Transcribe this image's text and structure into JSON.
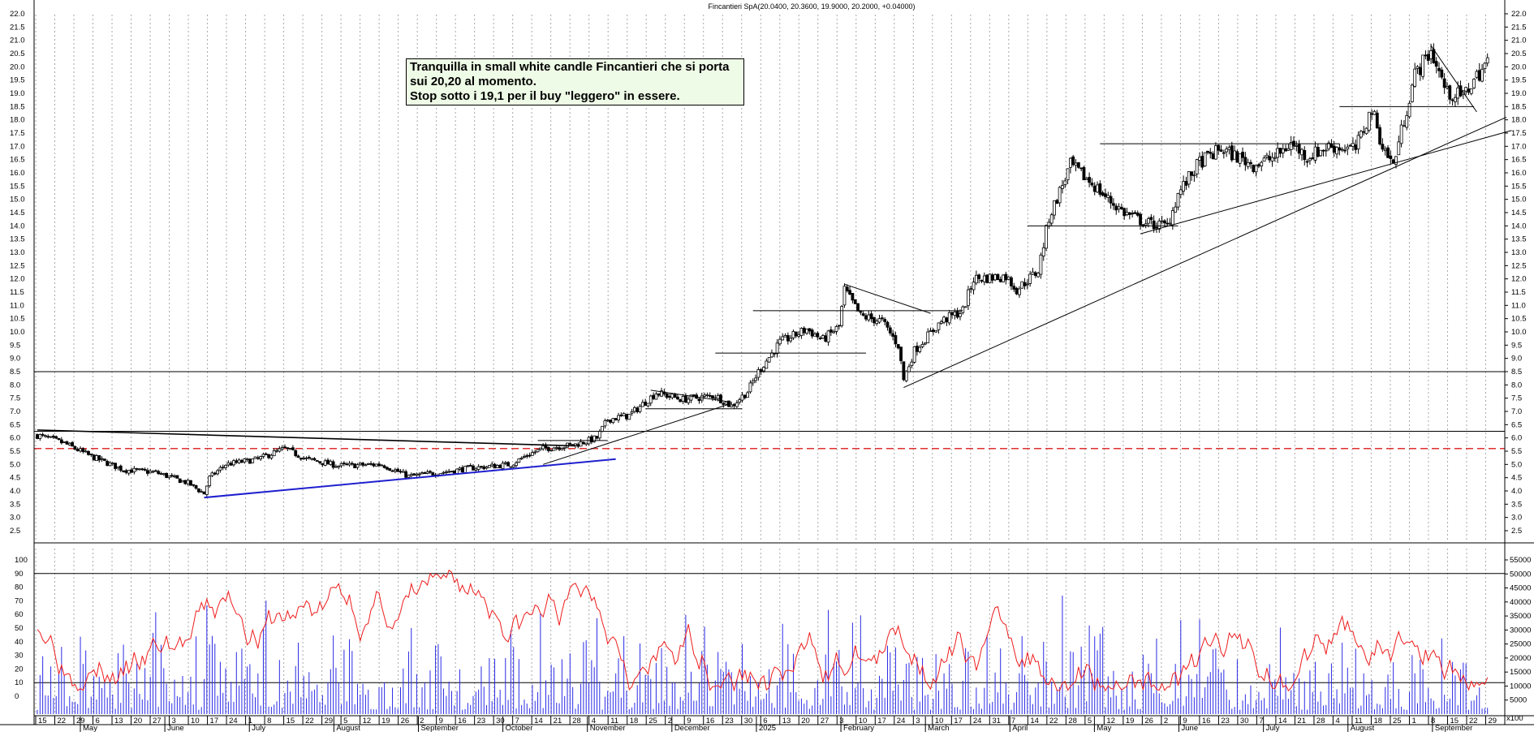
{
  "header": {
    "title": "Fincantieri SpA(20.0400, 20.3600, 19.9000, 20.2000, +0.04000)"
  },
  "annotation": {
    "line1": "Tranquilla in small white candle Fincantieri che si porta",
    "line2": "sui 20,20 al momento.",
    "line3": "Stop sotto i 19,1 per il buy \"leggero\" in essere."
  },
  "colors": {
    "candle": "#000000",
    "trendline_black": "#000000",
    "trendline_blue": "#1f1fcf",
    "support_dashed": "#e03030",
    "oscillator": "#ee1c1c",
    "volume": "#2a2ae6",
    "grid": "#a8a8a8"
  },
  "chart_data": [
    {
      "type": "candlestick",
      "title": "Fincantieri SpA(20.0400, 20.3600, 19.9000, 20.2000, +0.04000)",
      "ylim": [
        2.0,
        22.5
      ],
      "y_ticks": [
        "22.0",
        "21.5",
        "21.0",
        "20.5",
        "20.0",
        "19.5",
        "19.0",
        "18.5",
        "18.0",
        "17.5",
        "17.0",
        "16.5",
        "16.0",
        "15.5",
        "15.0",
        "14.5",
        "14.0",
        "13.5",
        "13.0",
        "12.5",
        "12.0",
        "11.5",
        "11.0",
        "10.5",
        "10.0",
        "9.5",
        "9.0",
        "8.5",
        "8.0",
        "7.5",
        "7.0",
        "6.5",
        "6.0",
        "5.5",
        "5.0",
        "4.5",
        "4.0",
        "3.5",
        "3.0",
        "2.5"
      ],
      "last": {
        "open": 20.04,
        "high": 20.36,
        "low": 19.9,
        "close": 20.2,
        "change": 0.04
      },
      "horizontal_levels": [
        8.5,
        6.25
      ],
      "dashed_level": 5.6,
      "close_path": [
        [
          0,
          6.1
        ],
        [
          10,
          5.8
        ],
        [
          20,
          5.3
        ],
        [
          32,
          4.8
        ],
        [
          44,
          4.7
        ],
        [
          56,
          4.3
        ],
        [
          62,
          3.9
        ],
        [
          64,
          4.5
        ],
        [
          70,
          5.0
        ],
        [
          82,
          5.2
        ],
        [
          92,
          5.6
        ],
        [
          100,
          5.2
        ],
        [
          112,
          4.95
        ],
        [
          128,
          5.0
        ],
        [
          138,
          4.55
        ],
        [
          150,
          4.7
        ],
        [
          160,
          4.85
        ],
        [
          176,
          5.0
        ],
        [
          182,
          5.35
        ],
        [
          188,
          5.6
        ],
        [
          200,
          5.75
        ],
        [
          208,
          6.0
        ],
        [
          212,
          6.7
        ],
        [
          220,
          6.85
        ],
        [
          230,
          7.7
        ],
        [
          240,
          7.45
        ],
        [
          252,
          7.6
        ],
        [
          258,
          7.2
        ],
        [
          264,
          7.75
        ],
        [
          268,
          8.5
        ],
        [
          276,
          9.6
        ],
        [
          286,
          10.1
        ],
        [
          292,
          9.7
        ],
        [
          298,
          10.2
        ],
        [
          300,
          11.6
        ],
        [
          306,
          10.6
        ],
        [
          314,
          10.4
        ],
        [
          320,
          9.5
        ],
        [
          322,
          8.2
        ],
        [
          326,
          9.3
        ],
        [
          336,
          10.4
        ],
        [
          344,
          10.8
        ],
        [
          348,
          12.0
        ],
        [
          360,
          12.1
        ],
        [
          364,
          11.6
        ],
        [
          372,
          12.3
        ],
        [
          376,
          14.3
        ],
        [
          384,
          16.3
        ],
        [
          392,
          15.6
        ],
        [
          398,
          15.0
        ],
        [
          404,
          14.5
        ],
        [
          412,
          14.1
        ],
        [
          420,
          14.0
        ],
        [
          424,
          15.2
        ],
        [
          432,
          16.4
        ],
        [
          440,
          16.9
        ],
        [
          452,
          16.3
        ],
        [
          460,
          16.6
        ],
        [
          466,
          17.1
        ],
        [
          472,
          16.6
        ],
        [
          480,
          17.0
        ],
        [
          490,
          16.9
        ],
        [
          496,
          18.4
        ],
        [
          500,
          17.0
        ],
        [
          504,
          16.3
        ],
        [
          512,
          19.7
        ],
        [
          518,
          20.6
        ],
        [
          524,
          19.0
        ],
        [
          530,
          18.9
        ],
        [
          534,
          19.5
        ],
        [
          539,
          20.2
        ]
      ],
      "x_days": [
        "15",
        "22",
        "29",
        "6",
        "13",
        "20",
        "27",
        "3",
        "10",
        "17",
        "24",
        "1",
        "8",
        "15",
        "22",
        "29",
        "5",
        "12",
        "19",
        "26",
        "2",
        "9",
        "16",
        "23",
        "30",
        "7",
        "14",
        "21",
        "28",
        "4",
        "11",
        "18",
        "25",
        "2",
        "9",
        "16",
        "23",
        "30",
        "6",
        "13",
        "20",
        "27",
        "3",
        "10",
        "17",
        "24",
        "3",
        "10",
        "17",
        "24",
        "31",
        "7",
        "14",
        "22",
        "28",
        "5",
        "12",
        "19",
        "26",
        "2",
        "9",
        "16",
        "23",
        "30",
        "7",
        "14",
        "21",
        "28",
        "4",
        "11",
        "18",
        "25",
        "1",
        "8",
        "15",
        "22",
        "29"
      ],
      "x_months": [
        "May",
        "June",
        "July",
        "August",
        "September",
        "October",
        "November",
        "December",
        "2025",
        "February",
        "March",
        "April",
        "May",
        "June",
        "July",
        "August",
        "September"
      ]
    },
    {
      "type": "line",
      "series": [
        {
          "kind": "oscillator",
          "color": "#ee1c1c"
        },
        {
          "kind": "volume",
          "color": "#2a2ae6"
        }
      ],
      "ylim": [
        -10,
        105
      ],
      "y_ticks": [
        "100",
        "90",
        "80",
        "70",
        "60",
        "50",
        "40",
        "30",
        "20",
        "10",
        "0"
      ],
      "y2_ticks": [
        "55000",
        "50000",
        "45000",
        "40000",
        "35000",
        "30000",
        "25000",
        "20000",
        "15000",
        "10000",
        "5000"
      ],
      "y2_label": "x100",
      "horizontal_levels": [
        90,
        10
      ]
    }
  ]
}
